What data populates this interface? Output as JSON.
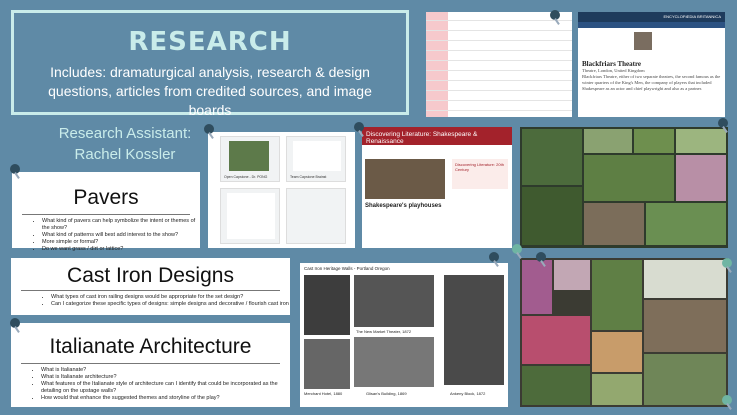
{
  "banner": {
    "title": "RESEARCH",
    "subtitle": "Includes: dramaturgical analysis, research & design questions,  articles from credited sources, and image boards"
  },
  "assistant": {
    "role": "Research Assistant:",
    "name": "Rachel Kossler"
  },
  "cards": {
    "pavers": {
      "heading": "Pavers",
      "bullets": [
        "What kind of pavers can help symbolize the intent or themes of the show?",
        "What kind of patterns will best add interest to the show?",
        "More simple or formal?",
        "Do we want grass / dirt or lattice?"
      ]
    },
    "cast_iron": {
      "heading": "Cast Iron Designs",
      "bullets": [
        "What types of cast iron railing designs would be appropriate for the set design?",
        "Can I categorize these specific types of designs:  simple designs and decorative / flourish cast iron"
      ]
    },
    "italianate": {
      "heading": "Italianate Architecture",
      "bullets": [
        "What is Italianate?",
        "What is Italianate architecture?",
        "What features of the Italianate style of architecture can I identify that could be incorporated as the detailing on the upstage walls?",
        "How would that enhance the suggested themes and storyline of the play?"
      ]
    }
  },
  "encyclopedia": {
    "header": "ENCYCLOPÆDIA BRITANNICA",
    "heading": "Blackfriars Theatre",
    "meta": "Theatre, London, United Kingdom",
    "body": "Blackfriars Theatre, either of two separate theatres, the second famous as the winter quarters of the King's Men, the company of players that included Shakespeare as an actor and chief playwright and also as a partner."
  },
  "drive": {
    "files": [
      "Open Capstone - Dr. PONG",
      "Team Capstone Brainst"
    ]
  },
  "literature": {
    "banner": "Discovering Literature: Shakespeare & Renaissance",
    "page_title": "Shakespeare's playhouses",
    "side_title": "Discovering Literature: 20th Century"
  },
  "architecture": {
    "title": "Cast Iron Heritage Walls - Portland Oregon",
    "captions": [
      "The New Market Theater, 1872",
      "Merchant Hotel, 1880",
      "Glisan's Building, 1869",
      "Ankeny Block, 1872"
    ]
  },
  "pin_color": "#2f4d5e",
  "accent": "#c9ecea"
}
